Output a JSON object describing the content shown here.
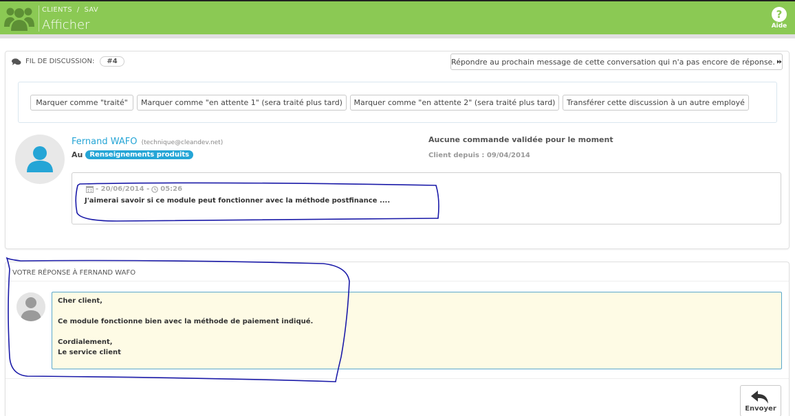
{
  "header": {
    "breadcrumb": [
      "CLIENTS",
      "SAV"
    ],
    "breadcrumb_sep": "/",
    "title": "Afficher",
    "help_label": "Aide",
    "help_icon_glyph": "?",
    "brand_color": "#8bc954"
  },
  "thread": {
    "label": "FIL DE DISCUSSION:",
    "number": "#4",
    "next_button": "Répondre au prochain message de cette conversation qui n'a pas encore de réponse.",
    "next_icon": "fast-forward-icon"
  },
  "actions": [
    "Marquer comme \"traité\"",
    "Marquer comme \"en attente 1\" (sera traité plus tard)",
    "Marquer comme \"en attente 2\" (sera traité plus tard)",
    "Transférer cette discussion à un autre employé"
  ],
  "customer": {
    "name": "Fernand WAFO",
    "email": "(technique@cleandev.net)",
    "topic_prefix": "Au",
    "topic": "Renseignements produits",
    "orders": "Aucune commande validée pour le moment",
    "client_since": "Client depuis : 09/04/2014"
  },
  "message": {
    "date": "- 20/06/2014 -",
    "time": "05:26",
    "text": "J'aimerai savoir si ce module peut fonctionner avec la méthode postfinance ...."
  },
  "reply": {
    "heading": "VOTRE RÉPONSE À FERNAND WAFO",
    "body": "Cher client,\n\nCe module fonctionne bien avec la méthode de paiement indiqué.\n\nCordialement,\nLe service client",
    "send_label": "Envoyer"
  },
  "colors": {
    "accent_blue": "#25a5d6",
    "annotation_ink": "#1a1aa8",
    "reply_bg": "#fefbe5"
  }
}
